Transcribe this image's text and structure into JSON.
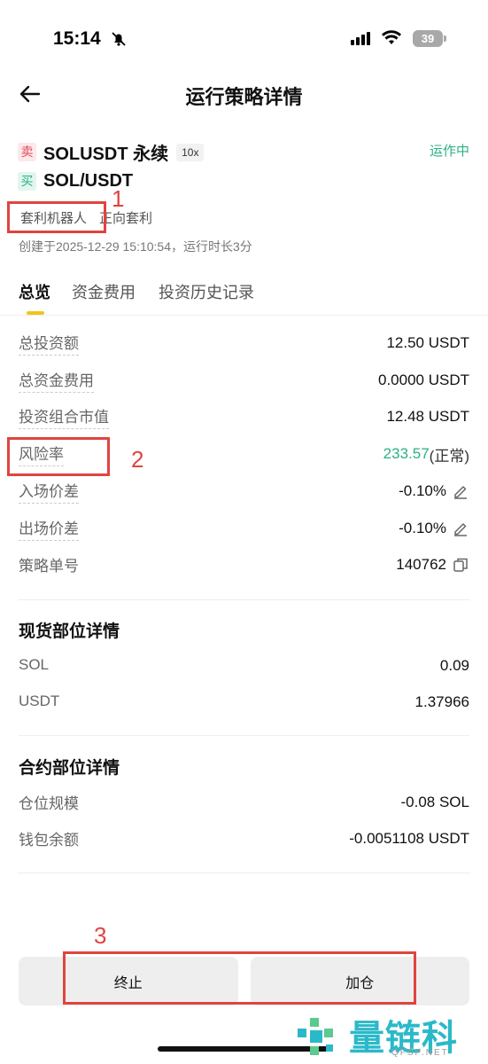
{
  "status_bar": {
    "time": "15:14",
    "battery": "39"
  },
  "header": {
    "title": "运行策略详情"
  },
  "pairs": [
    {
      "side": "卖",
      "name": "SOLUSDT 永续",
      "leverage": "10x"
    },
    {
      "side": "买",
      "name": "SOL/USDT"
    }
  ],
  "run_status": "运作中",
  "tags": [
    "套利机器人",
    "正向套利"
  ],
  "created": "创建于2025-12-29 15:10:54，运行时长3分",
  "tabs": [
    "总览",
    "资金费用",
    "投资历史记录"
  ],
  "overview": {
    "total_investment": {
      "label": "总投资额",
      "value": "12.50 USDT"
    },
    "total_funding_fee": {
      "label": "总资金费用",
      "value": "0.0000 USDT"
    },
    "portfolio_value": {
      "label": "投资组合市值",
      "value": "12.48 USDT"
    },
    "risk_rate": {
      "label": "风险率",
      "value": "233.57",
      "suffix": "(正常)"
    },
    "entry_spread": {
      "label": "入场价差",
      "value": "-0.10%"
    },
    "exit_spread": {
      "label": "出场价差",
      "value": "-0.10%"
    },
    "strategy_id": {
      "label": "策略单号",
      "value": "140762"
    }
  },
  "spot_section": {
    "title": "现货部位详情",
    "rows": [
      {
        "label": "SOL",
        "value": "0.09"
      },
      {
        "label": "USDT",
        "value": "1.37966"
      }
    ]
  },
  "contract_section": {
    "title": "合约部位详情",
    "rows": [
      {
        "label": "仓位规模",
        "value": "-0.08 SOL"
      },
      {
        "label": "钱包余额",
        "value": "-0.0051108 USDT"
      }
    ]
  },
  "buttons": {
    "stop": "终止",
    "add": "加仓"
  },
  "annotations": [
    "1",
    "2",
    "3"
  ],
  "watermark": {
    "text": "量链科技",
    "sub": "QFSP.NET"
  },
  "colors": {
    "green": "#2bb184",
    "red": "#e04a5e",
    "accent": "#f0c419",
    "annotation": "#e0443f"
  }
}
